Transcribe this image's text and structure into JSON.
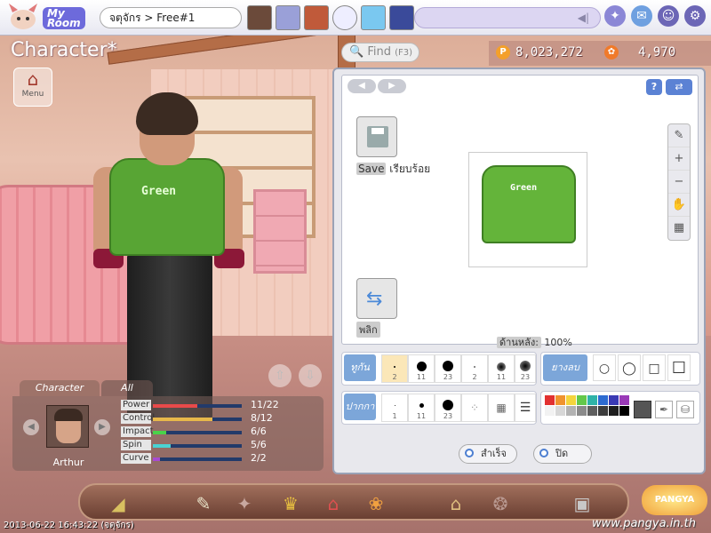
{
  "topbar": {
    "myroom_line1": "My",
    "myroom_line2": "Room",
    "channel": "จตุจักร > Free#1"
  },
  "title": "Character",
  "title_mark": "*",
  "menu": {
    "label": "Menu"
  },
  "find": {
    "label": "Find",
    "shortcut": "(F3)"
  },
  "currency": {
    "pang": "8,023,272",
    "cookie": "4,970",
    "pang_icon": "P",
    "cookie_icon": "✿"
  },
  "editor": {
    "save_en": "Save",
    "save_th": "เรียบร้อย",
    "flip_label": "พลิก",
    "view_key": "ด้านหลัง:",
    "view_value": "100%",
    "preview_text": "Green",
    "brush_tag": "ทูกัน",
    "eraser_tag": "ยางลบ",
    "pen_tag": "ปากกา",
    "brush_sizes": [
      "2",
      "11",
      "23",
      "2",
      "11",
      "23"
    ],
    "pen_sizes": [
      "1",
      "11",
      "23"
    ],
    "ok_label": "สำเร็จ",
    "close_label": "ปิด"
  },
  "palette_colors": [
    "#e23131",
    "#f0932e",
    "#f4d43c",
    "#63c84a",
    "#2fb3a8",
    "#2d6bd1",
    "#3a3ab4",
    "#9a3ab8",
    "#f2f2f2",
    "#d7d7d7",
    "#b2b2b2",
    "#8a8a8a",
    "#5e5e5e",
    "#3c3c3c",
    "#1e1e1e",
    "#000000"
  ],
  "character": {
    "tab_char": "Character",
    "tab_all": "All",
    "name": "Arthur",
    "stats": [
      {
        "label": "Power",
        "value": "11/22",
        "fill": 0.5,
        "color": "#e84a4a"
      },
      {
        "label": "Control",
        "value": "8/12",
        "fill": 0.67,
        "color": "#e8b84a"
      },
      {
        "label": "Impact",
        "value": "6/6",
        "fill": 0.15,
        "color": "#4ad24a"
      },
      {
        "label": "Spin",
        "value": "5/6",
        "fill": 0.2,
        "color": "#4ad2d2"
      },
      {
        "label": "Curve",
        "value": "2/2",
        "fill": 0.08,
        "color": "#a84ad2"
      }
    ]
  },
  "footer": {
    "timestamp": "2013-06-22 16:43:22 (จตุจักร)",
    "site": "www.pangya.in.th",
    "logo": "PANGYA"
  }
}
